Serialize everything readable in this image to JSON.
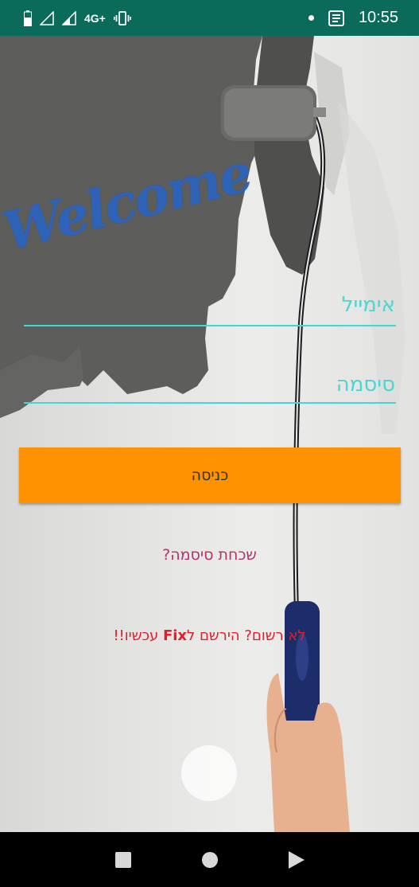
{
  "status_bar": {
    "network": "4G+",
    "time": "10:55"
  },
  "welcome_text": "Welcome",
  "form": {
    "email_placeholder": "אימייל",
    "password_placeholder": "סיסמה",
    "login_button": "כניסה",
    "forgot_password": "שכחת סיסמה?",
    "register_prefix": "לא רשום? הירשם ל",
    "register_brand": "Fix",
    "register_suffix": " עכשיו!!"
  },
  "colors": {
    "status_bar": "#0b6b5a",
    "accent_field": "#3fd8d4",
    "button": "#ff9200",
    "forgot": "#b5316c",
    "register": "#e61b2a",
    "welcome": "#2f63b8"
  },
  "icons": {
    "battery": "battery-icon",
    "signal_1": "signal-icon",
    "signal_2": "signal-icon",
    "vibrate": "vibrate-icon",
    "notification": "notification-dot-icon",
    "app_notification": "news-icon",
    "recents": "square-icon",
    "home": "circle-icon",
    "back": "triangle-back-icon"
  }
}
